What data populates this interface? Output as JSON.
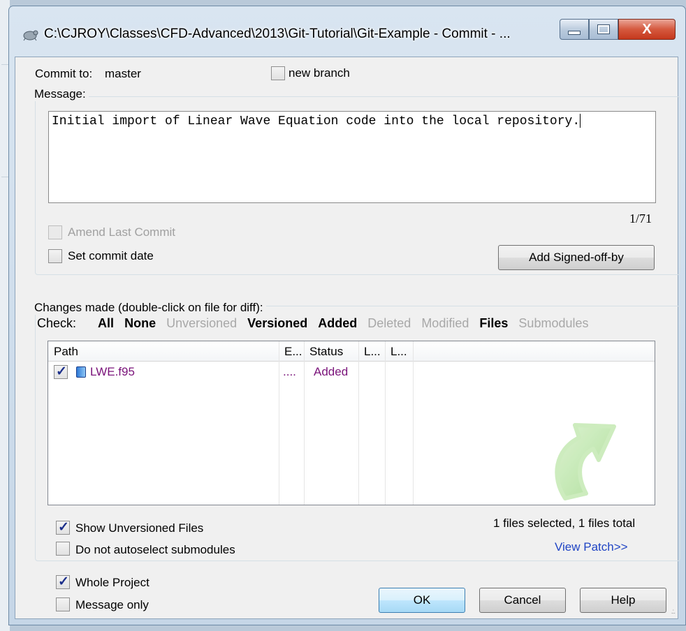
{
  "window": {
    "title": "C:\\CJROY\\Classes\\CFD-Advanced\\2013\\Git-Tutorial\\Git-Example - Commit - ...",
    "close_glyph": "X"
  },
  "commit": {
    "commit_to_label": "Commit to:",
    "branch": "master",
    "new_branch_label": "new branch",
    "new_branch_checked": false
  },
  "message": {
    "group_label": "Message:",
    "text": "Initial import of Linear Wave Equation code into the local repository.",
    "counter": "1/71",
    "amend_label": "Amend Last Commit",
    "amend_checked": false,
    "set_date_label": "Set commit date",
    "set_date_checked": false,
    "signed_off_button": "Add Signed-off-by"
  },
  "changes": {
    "group_label": "Changes made (double-click on file for diff):",
    "check_label": "Check:",
    "filters": [
      {
        "label": "All",
        "active": true
      },
      {
        "label": "None",
        "active": true
      },
      {
        "label": "Unversioned",
        "active": false
      },
      {
        "label": "Versioned",
        "active": true
      },
      {
        "label": "Added",
        "active": true
      },
      {
        "label": "Deleted",
        "active": false
      },
      {
        "label": "Modified",
        "active": false
      },
      {
        "label": "Files",
        "active": true
      },
      {
        "label": "Submodules",
        "active": false
      }
    ],
    "columns": [
      "Path",
      "E...",
      "Status",
      "L...",
      "L..."
    ],
    "rows": [
      {
        "path": "LWE.f95",
        "ext": "....",
        "status": "Added",
        "checked": true
      }
    ],
    "show_unversioned_label": "Show Unversioned Files",
    "show_unversioned_checked": true,
    "no_autoselect_label": "Do not autoselect submodules",
    "no_autoselect_checked": false,
    "selection_summary": "1 files selected, 1 files total",
    "view_patch_link": "View Patch>>"
  },
  "footer": {
    "whole_project_label": "Whole Project",
    "whole_project_checked": true,
    "message_only_label": "Message only",
    "message_only_checked": false,
    "ok_button": "OK",
    "cancel_button": "Cancel",
    "help_button": "Help"
  },
  "colors": {
    "link": "#1f44c4",
    "added_file": "#7a137a",
    "close_button": "#c5381d"
  }
}
